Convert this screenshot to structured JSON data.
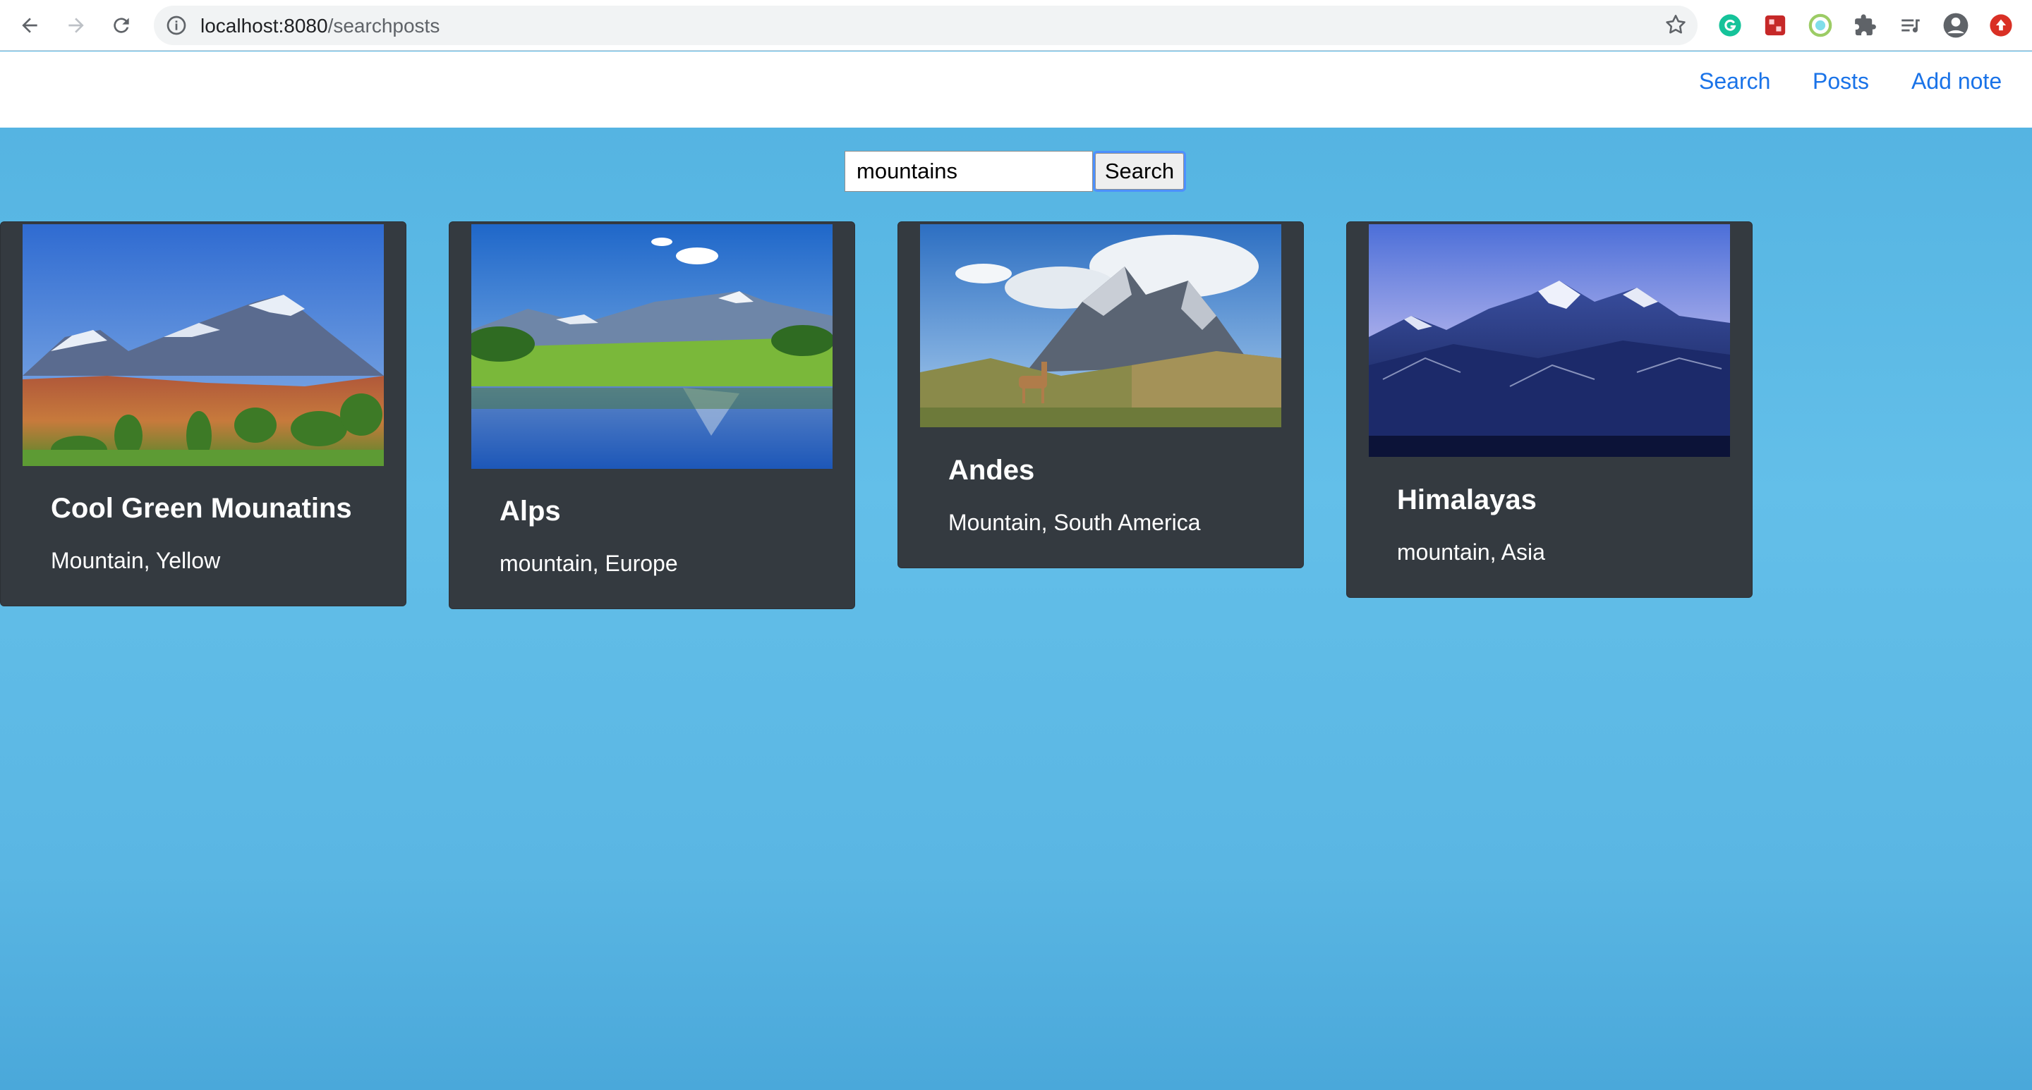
{
  "browser": {
    "url_host": "localhost:8080",
    "url_path": "/searchposts"
  },
  "nav": {
    "links": [
      {
        "label": "Search"
      },
      {
        "label": "Posts"
      },
      {
        "label": "Add note"
      }
    ]
  },
  "search": {
    "query": "mountains",
    "button_label": "Search"
  },
  "posts": [
    {
      "title": "Cool Green Mounatins",
      "tags": "Mountain, Yellow"
    },
    {
      "title": "Alps",
      "tags": "mountain, Europe"
    },
    {
      "title": "Andes",
      "tags": "Mountain, South America"
    },
    {
      "title": "Himalayas",
      "tags": "mountain, Asia"
    }
  ],
  "colors": {
    "page_background": "#5ab6e3",
    "card_background": "#343a40",
    "link": "#1a73e8"
  }
}
